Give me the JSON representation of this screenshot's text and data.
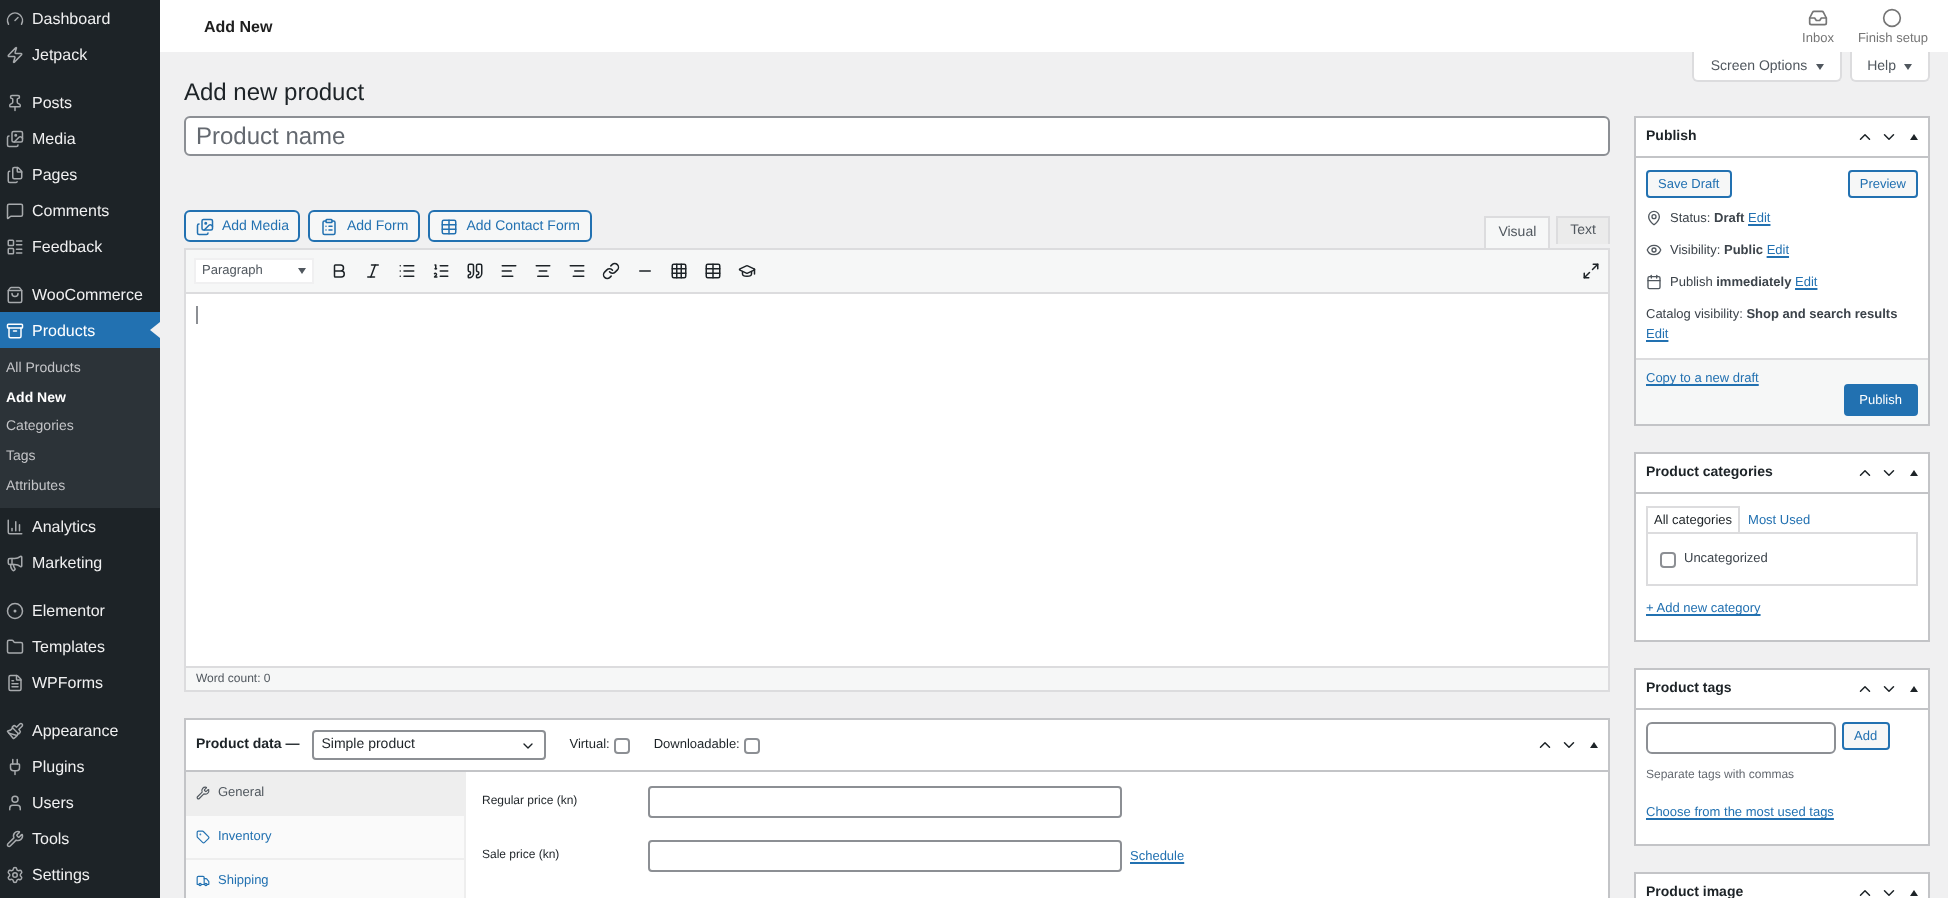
{
  "top_bar": {
    "title": "Add New",
    "actions": [
      {
        "label": "Inbox",
        "kind": "inbox"
      },
      {
        "label": "Finish setup",
        "kind": "setup"
      }
    ]
  },
  "sidebar": {
    "groups": [
      [
        {
          "label": "Dashboard",
          "selected": false
        },
        {
          "label": "Jetpack",
          "selected": false
        }
      ],
      [
        {
          "label": "Posts",
          "selected": false
        },
        {
          "label": "Media",
          "selected": false
        },
        {
          "label": "Pages",
          "selected": false
        },
        {
          "label": "Comments",
          "selected": false
        },
        {
          "label": "Feedback",
          "selected": false
        }
      ],
      [
        {
          "label": "WooCommerce",
          "selected": false
        },
        {
          "label": "Products",
          "selected": true,
          "children": [
            {
              "label": "All Products",
              "selected": false
            },
            {
              "label": "Add New",
              "selected": true
            },
            {
              "label": "Categories",
              "selected": false
            },
            {
              "label": "Tags",
              "selected": false
            },
            {
              "label": "Attributes",
              "selected": false
            }
          ]
        },
        {
          "label": "Analytics",
          "selected": false
        },
        {
          "label": "Marketing",
          "selected": false
        }
      ],
      [
        {
          "label": "Elementor",
          "selected": false
        },
        {
          "label": "Templates",
          "selected": false
        },
        {
          "label": "WPForms",
          "selected": false
        }
      ],
      [
        {
          "label": "Appearance",
          "selected": false
        },
        {
          "label": "Plugins",
          "selected": false
        },
        {
          "label": "Users",
          "selected": false
        },
        {
          "label": "Tools",
          "selected": false
        },
        {
          "label": "Settings",
          "selected": false
        }
      ]
    ]
  },
  "screen_buttons": [
    "Screen Options",
    "Help"
  ],
  "page_title": "Add new product",
  "product_name": {
    "placeholder": "Product name"
  },
  "media_buttons": [
    "Add Media",
    "Add Form",
    "Add Contact Form"
  ],
  "editor_tabs": [
    {
      "label": "Visual",
      "selected": true
    },
    {
      "label": "Text",
      "selected": false
    }
  ],
  "format_select": "Paragraph",
  "word_count": "Word count: 0",
  "product_data": {
    "title": "Product data —",
    "type_select": "Simple product",
    "options": [
      {
        "label": "Virtual:",
        "checked": false
      },
      {
        "label": "Downloadable:",
        "checked": false
      }
    ],
    "tabs": [
      {
        "label": "General",
        "selected": true
      },
      {
        "label": "Inventory",
        "selected": false
      },
      {
        "label": "Shipping",
        "selected": false
      }
    ],
    "fields": [
      {
        "label": "Regular price (kn)"
      },
      {
        "label": "Sale price (kn)",
        "link": "Schedule"
      }
    ]
  },
  "publish": {
    "title": "Publish",
    "save_draft": "Save Draft",
    "preview": "Preview",
    "meta": [
      {
        "kind": "status",
        "text": "Status: **Draft**",
        "link": "Edit"
      },
      {
        "kind": "visibility",
        "text": "Visibility: **Public**",
        "link": "Edit"
      },
      {
        "kind": "schedule",
        "text": "Publish **immediately**",
        "link": "Edit"
      },
      {
        "kind": "catalog",
        "text": "Catalog visibility: **Shop and search results**",
        "link": "Edit"
      }
    ],
    "copy_link": "Copy to a new draft",
    "publish_button": "Publish"
  },
  "categories": {
    "title": "Product categories",
    "tabs": [
      {
        "label": "All categories",
        "selected": true
      },
      {
        "label": "Most Used",
        "selected": false
      }
    ],
    "items": [
      {
        "label": "Uncategorized",
        "checked": false
      }
    ],
    "add_link": "+ Add new category"
  },
  "tags": {
    "title": "Product tags",
    "button": "Add",
    "hint": "Separate tags with commas",
    "link": "Choose from the most used tags"
  },
  "product_image": {
    "title": "Product image"
  }
}
